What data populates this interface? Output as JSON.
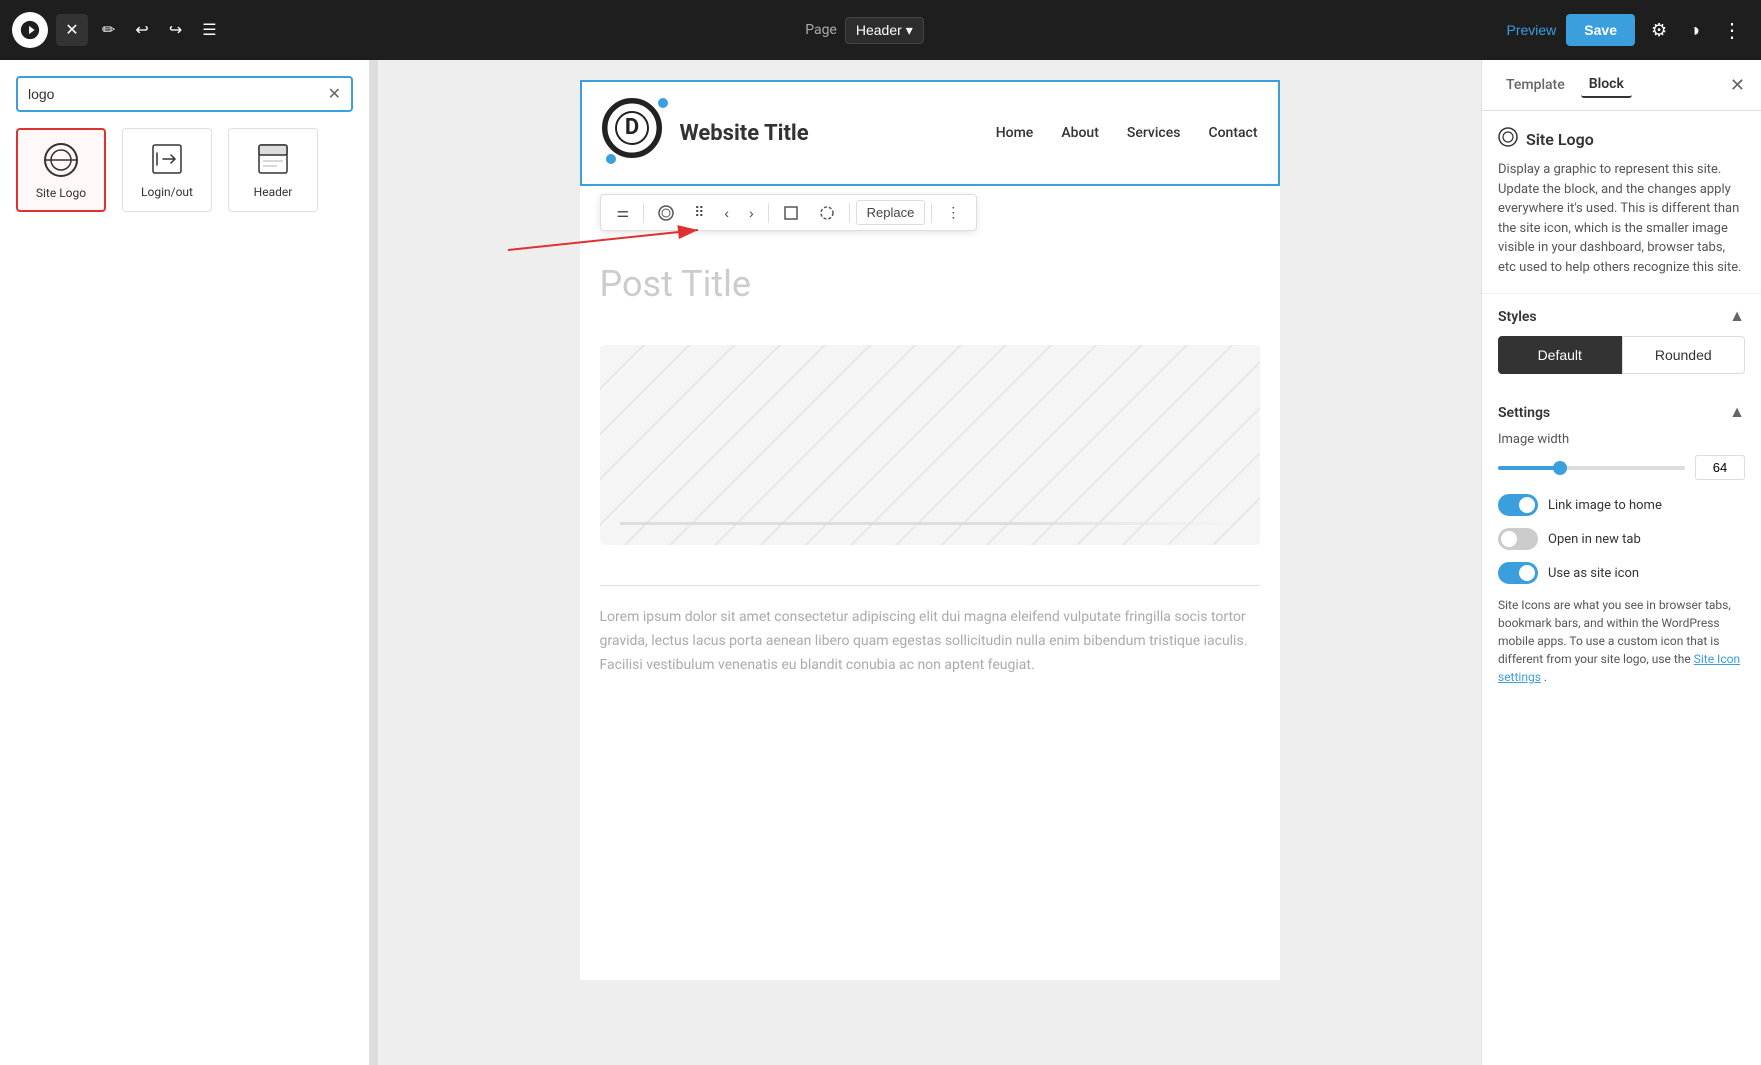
{
  "toolbar": {
    "page_label": "Page",
    "page_name": "Header",
    "preview_label": "Preview",
    "save_label": "Save"
  },
  "left_sidebar": {
    "search_placeholder": "logo",
    "search_value": "logo",
    "blocks": [
      {
        "id": "site-logo",
        "label": "Site Logo",
        "selected": true
      },
      {
        "id": "login-out",
        "label": "Login/out",
        "selected": false
      },
      {
        "id": "header",
        "label": "Header",
        "selected": false
      }
    ]
  },
  "canvas": {
    "nav_items": [
      "Home",
      "About",
      "Services",
      "Contact"
    ],
    "site_title": "Website Title",
    "post_title": "Post Title",
    "lorem_text": "Lorem ipsum dolor sit amet consectetur adipiscing elit dui magna eleifend vulputate fringilla socis tortor gravida, lectus lacus porta aenean libero quam egestas sollicitudin nulla enim bibendum tristique iaculis. Facilisi vestibulum venenatis eu blandit conubia ac non aptent feugiat."
  },
  "right_panel": {
    "tabs": [
      "Template",
      "Block"
    ],
    "active_tab": "Block",
    "site_logo": {
      "title": "Site Logo",
      "description": "Display a graphic to represent this site. Update the block, and the changes apply everywhere it's used. This is different than the site icon, which is the smaller image visible in your dashboard, browser tabs, etc used to help others recognize this site."
    },
    "styles": {
      "title": "Styles",
      "options": [
        "Default",
        "Rounded"
      ],
      "active": "Default"
    },
    "settings": {
      "title": "Settings",
      "image_width_label": "Image width",
      "image_width_value": "64",
      "link_image_label": "Link image to home",
      "link_image_enabled": true,
      "open_new_tab_label": "Open in new tab",
      "open_new_tab_enabled": false,
      "use_site_icon_label": "Use as site icon",
      "use_site_icon_enabled": true,
      "site_icon_text": "Site Icons are what you see in browser tabs, bookmark bars, and within the WordPress mobile apps. To use a custom icon that is different from your site logo, use the ",
      "site_icon_link_text": "Site Icon settings",
      "site_icon_text_end": "."
    }
  }
}
